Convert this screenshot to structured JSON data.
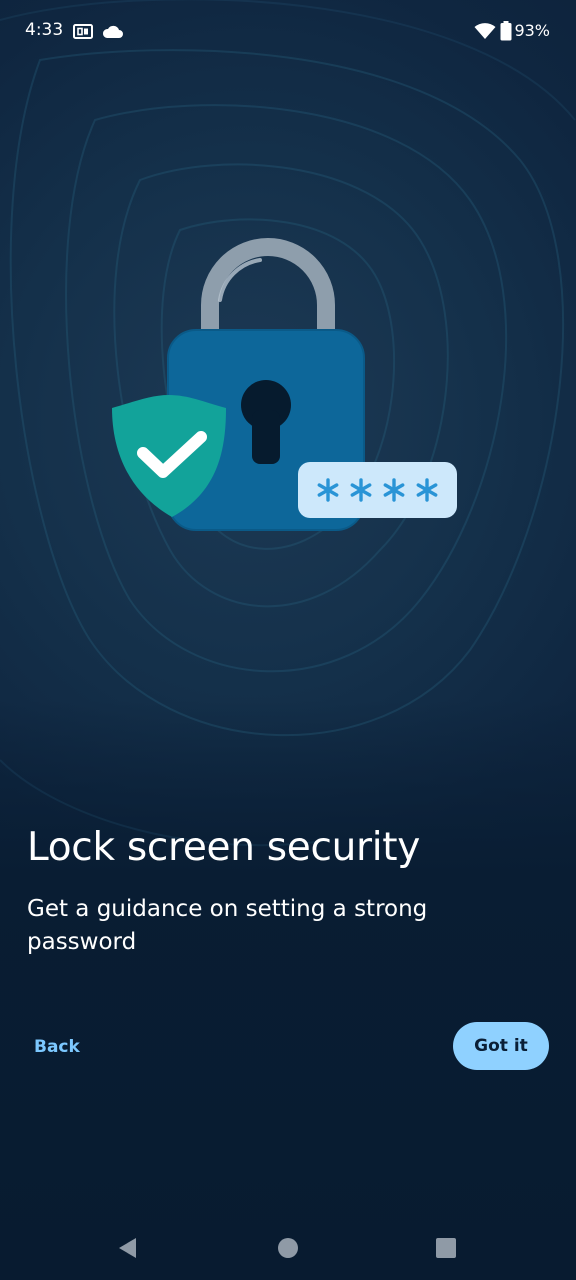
{
  "status_bar": {
    "time": "4:33",
    "battery": "93%",
    "icons": [
      "screen-cast-icon",
      "cloud-icon",
      "wifi-icon",
      "battery-icon"
    ]
  },
  "hero": {
    "icons": [
      "padlock-icon",
      "shield-check-icon",
      "password-field-icon"
    ],
    "password_mask": "****"
  },
  "content": {
    "title": "Lock screen security",
    "subtitle": "Get a guidance on setting a strong password"
  },
  "actions": {
    "back_label": "Back",
    "primary_label": "Got it"
  },
  "nav": {
    "icons": [
      "back-triangle-icon",
      "home-circle-icon",
      "recents-square-icon"
    ]
  },
  "colors": {
    "background": "#0b1f36",
    "accent": "#8fd1ff",
    "link": "#7cc8ff",
    "lock_body": "#0d679a",
    "shield": "#12a39a"
  }
}
